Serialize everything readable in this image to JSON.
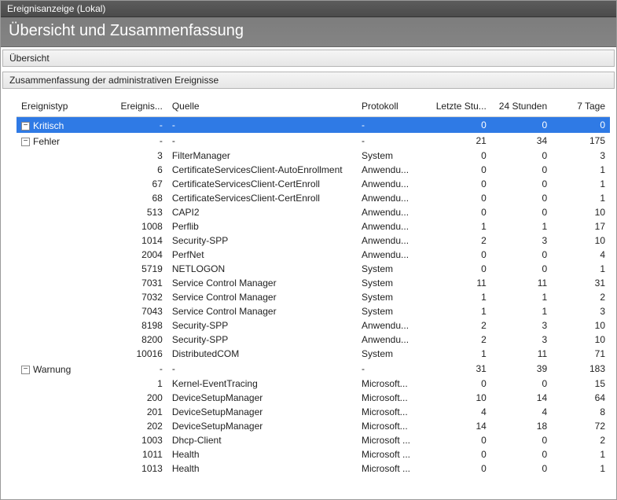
{
  "window": {
    "title": "Ereignisanzeige (Lokal)"
  },
  "header": {
    "title": "Übersicht und Zusammenfassung"
  },
  "sections": {
    "overview": "Übersicht",
    "summary": "Zusammenfassung der administrativen Ereignisse"
  },
  "columns": {
    "type": "Ereignistyp",
    "id": "Ereignis...",
    "source": "Quelle",
    "protocol": "Protokoll",
    "last_hour": "Letzte Stu...",
    "day": "24 Stunden",
    "week": "7 Tage"
  },
  "rows": [
    {
      "group": true,
      "selected": true,
      "type": "Kritisch",
      "id": "-",
      "source": "-",
      "protocol": "-",
      "h": "0",
      "d": "0",
      "w": "0"
    },
    {
      "group": true,
      "selected": false,
      "type": "Fehler",
      "id": "-",
      "source": "-",
      "protocol": "-",
      "h": "21",
      "d": "34",
      "w": "175"
    },
    {
      "group": false,
      "selected": false,
      "type": "",
      "id": "3",
      "source": "FilterManager",
      "protocol": "System",
      "h": "0",
      "d": "0",
      "w": "3"
    },
    {
      "group": false,
      "selected": false,
      "type": "",
      "id": "6",
      "source": "CertificateServicesClient-AutoEnrollment",
      "protocol": "Anwendu...",
      "h": "0",
      "d": "0",
      "w": "1"
    },
    {
      "group": false,
      "selected": false,
      "type": "",
      "id": "67",
      "source": "CertificateServicesClient-CertEnroll",
      "protocol": "Anwendu...",
      "h": "0",
      "d": "0",
      "w": "1"
    },
    {
      "group": false,
      "selected": false,
      "type": "",
      "id": "68",
      "source": "CertificateServicesClient-CertEnroll",
      "protocol": "Anwendu...",
      "h": "0",
      "d": "0",
      "w": "1"
    },
    {
      "group": false,
      "selected": false,
      "type": "",
      "id": "513",
      "source": "CAPI2",
      "protocol": "Anwendu...",
      "h": "0",
      "d": "0",
      "w": "10"
    },
    {
      "group": false,
      "selected": false,
      "type": "",
      "id": "1008",
      "source": "Perflib",
      "protocol": "Anwendu...",
      "h": "1",
      "d": "1",
      "w": "17"
    },
    {
      "group": false,
      "selected": false,
      "type": "",
      "id": "1014",
      "source": "Security-SPP",
      "protocol": "Anwendu...",
      "h": "2",
      "d": "3",
      "w": "10"
    },
    {
      "group": false,
      "selected": false,
      "type": "",
      "id": "2004",
      "source": "PerfNet",
      "protocol": "Anwendu...",
      "h": "0",
      "d": "0",
      "w": "4"
    },
    {
      "group": false,
      "selected": false,
      "type": "",
      "id": "5719",
      "source": "NETLOGON",
      "protocol": "System",
      "h": "0",
      "d": "0",
      "w": "1"
    },
    {
      "group": false,
      "selected": false,
      "type": "",
      "id": "7031",
      "source": "Service Control Manager",
      "protocol": "System",
      "h": "11",
      "d": "11",
      "w": "31"
    },
    {
      "group": false,
      "selected": false,
      "type": "",
      "id": "7032",
      "source": "Service Control Manager",
      "protocol": "System",
      "h": "1",
      "d": "1",
      "w": "2"
    },
    {
      "group": false,
      "selected": false,
      "type": "",
      "id": "7043",
      "source": "Service Control Manager",
      "protocol": "System",
      "h": "1",
      "d": "1",
      "w": "3"
    },
    {
      "group": false,
      "selected": false,
      "type": "",
      "id": "8198",
      "source": "Security-SPP",
      "protocol": "Anwendu...",
      "h": "2",
      "d": "3",
      "w": "10"
    },
    {
      "group": false,
      "selected": false,
      "type": "",
      "id": "8200",
      "source": "Security-SPP",
      "protocol": "Anwendu...",
      "h": "2",
      "d": "3",
      "w": "10"
    },
    {
      "group": false,
      "selected": false,
      "type": "",
      "id": "10016",
      "source": "DistributedCOM",
      "protocol": "System",
      "h": "1",
      "d": "11",
      "w": "71"
    },
    {
      "group": true,
      "selected": false,
      "type": "Warnung",
      "id": "-",
      "source": "-",
      "protocol": "-",
      "h": "31",
      "d": "39",
      "w": "183"
    },
    {
      "group": false,
      "selected": false,
      "type": "",
      "id": "1",
      "source": "Kernel-EventTracing",
      "protocol": "Microsoft...",
      "h": "0",
      "d": "0",
      "w": "15"
    },
    {
      "group": false,
      "selected": false,
      "type": "",
      "id": "200",
      "source": "DeviceSetupManager",
      "protocol": "Microsoft...",
      "h": "10",
      "d": "14",
      "w": "64"
    },
    {
      "group": false,
      "selected": false,
      "type": "",
      "id": "201",
      "source": "DeviceSetupManager",
      "protocol": "Microsoft...",
      "h": "4",
      "d": "4",
      "w": "8"
    },
    {
      "group": false,
      "selected": false,
      "type": "",
      "id": "202",
      "source": "DeviceSetupManager",
      "protocol": "Microsoft...",
      "h": "14",
      "d": "18",
      "w": "72"
    },
    {
      "group": false,
      "selected": false,
      "type": "",
      "id": "1003",
      "source": "Dhcp-Client",
      "protocol": "Microsoft ...",
      "h": "0",
      "d": "0",
      "w": "2"
    },
    {
      "group": false,
      "selected": false,
      "type": "",
      "id": "1011",
      "source": "Health",
      "protocol": "Microsoft ...",
      "h": "0",
      "d": "0",
      "w": "1"
    },
    {
      "group": false,
      "selected": false,
      "type": "",
      "id": "1013",
      "source": "Health",
      "protocol": "Microsoft ...",
      "h": "0",
      "d": "0",
      "w": "1"
    }
  ]
}
